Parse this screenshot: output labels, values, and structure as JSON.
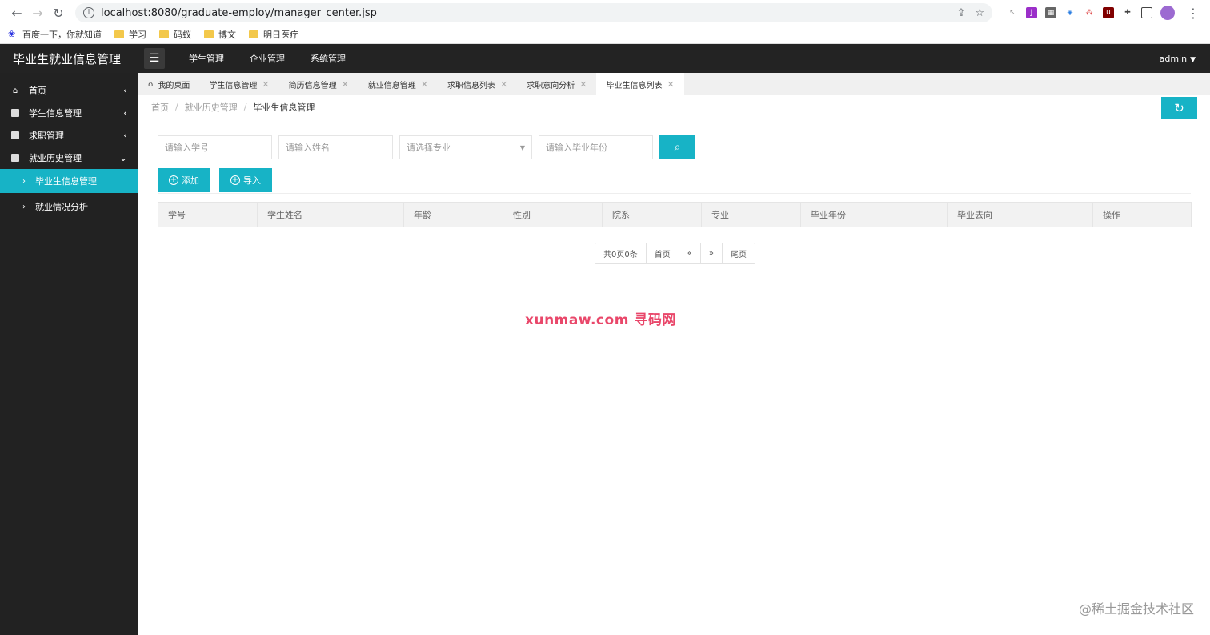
{
  "browser": {
    "url": "localhost:8080/graduate-employ/manager_center.jsp",
    "bookmarks": [
      "百度一下，你就知道",
      "学习",
      "码蚁",
      "博文",
      "明日医疗"
    ]
  },
  "header": {
    "brand": "毕业生就业信息管理",
    "nav": [
      "学生管理",
      "企业管理",
      "系统管理"
    ],
    "user": "admin"
  },
  "sidebar": {
    "items": [
      {
        "label": "首页",
        "icon": "home-icon"
      },
      {
        "label": "学生信息管理",
        "icon": "grid-icon"
      },
      {
        "label": "求职管理",
        "icon": "grid-icon"
      },
      {
        "label": "就业历史管理",
        "icon": "grid-icon"
      }
    ],
    "subitems": [
      {
        "label": "毕业生信息管理",
        "active": true
      },
      {
        "label": "就业情况分析",
        "active": false
      }
    ]
  },
  "tabs": [
    "我的桌面",
    "学生信息管理",
    "简历信息管理",
    "就业信息管理",
    "求职信息列表",
    "求职意向分析",
    "毕业生信息列表"
  ],
  "breadcrumb": [
    "首页",
    "就业历史管理",
    "毕业生信息管理"
  ],
  "filters": {
    "student_id_placeholder": "请输入学号",
    "name_placeholder": "请输入姓名",
    "major_select": "请选择专业",
    "year_placeholder": "请输入毕业年份"
  },
  "actions": {
    "add": "添加",
    "import": "导入"
  },
  "table": {
    "columns": [
      "学号",
      "学生姓名",
      "年龄",
      "性别",
      "院系",
      "专业",
      "毕业年份",
      "毕业去向",
      "操作"
    ]
  },
  "pager": {
    "summary": "共0页0条",
    "first": "首页",
    "prev": "«",
    "next": "»",
    "last": "尾页"
  },
  "watermark": "xunmaw.com 寻码网",
  "footer_mark": "@稀土掘金技术社区",
  "colors": {
    "accent": "#17b3c6",
    "sidebar_bg": "#222222",
    "topbar_bg": "#232323"
  }
}
